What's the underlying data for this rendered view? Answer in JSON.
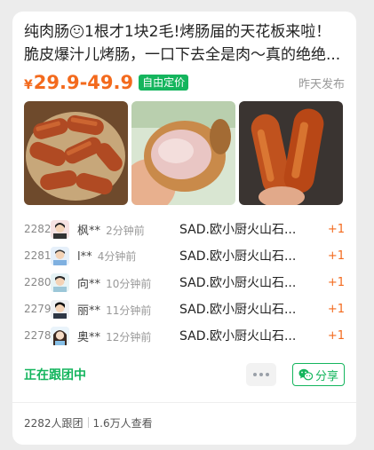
{
  "post": {
    "title_part1": "纯肉肠",
    "title_part2": "1根才1块2毛!烤肠届的天花板来啦！脆皮爆汁儿烤肠，一口下去全是肉～真的绝绝...",
    "price_symbol": "¥",
    "price_range": "29.9-49.9",
    "price_tag": "自由定价",
    "posted_time": "昨天发布"
  },
  "orders": [
    {
      "num": "2282",
      "name": "枫**",
      "time": "2分钟前",
      "product": "SAD.欧小厨火山石...",
      "qty": "+1"
    },
    {
      "num": "2281",
      "name": "l**",
      "time": "4分钟前",
      "product": "SAD.欧小厨火山石...",
      "qty": "+1"
    },
    {
      "num": "2280",
      "name": "向**",
      "time": "10分钟前",
      "product": "SAD.欧小厨火山石...",
      "qty": "+1"
    },
    {
      "num": "2279",
      "name": "丽**",
      "time": "11分钟前",
      "product": "SAD.欧小厨火山石...",
      "qty": "+1"
    },
    {
      "num": "2278",
      "name": "奥**",
      "time": "12分钟前",
      "product": "SAD.欧小厨火山石...",
      "qty": "+1"
    }
  ],
  "actions": {
    "status": "正在跟团中",
    "share_label": "分享"
  },
  "stats": {
    "joined": "2282人跟团",
    "views": "1.6万人查看"
  },
  "colors": {
    "accent_green": "#14b55d",
    "price_orange": "#f36a1d"
  },
  "icons": [
    "smile-emoji-icon",
    "more-dots-icon",
    "wechat-icon"
  ]
}
